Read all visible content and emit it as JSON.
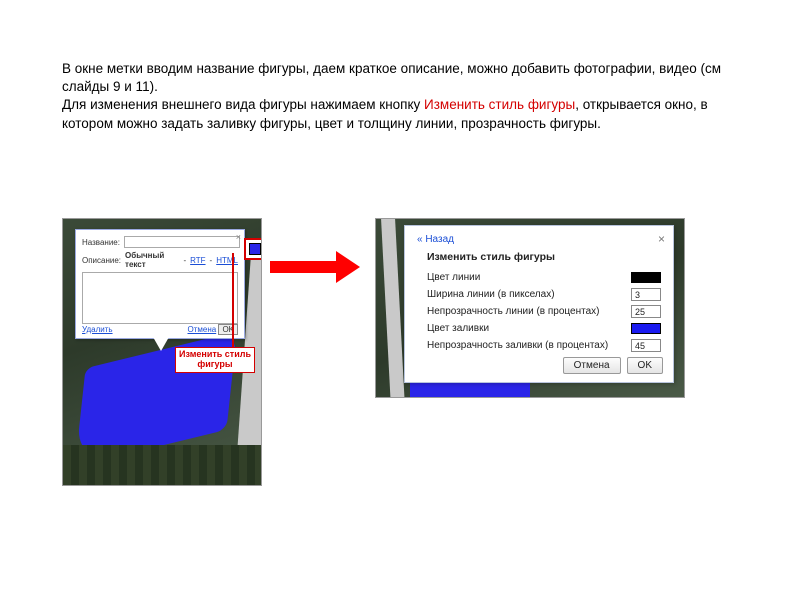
{
  "description": {
    "line1": "В окне метки вводим название фигуры, даем краткое описание, можно добавить фотографии, видео (см слайды 9 и 11).",
    "line2_pre": "Для изменения внешнего вида фигуры нажимаем кнопку ",
    "line2_hl": "Изменить стиль фигуры",
    "line2_post": ", открывается окно, в котором можно задать заливку фигуры, цвет и толщину линии, прозрачность фигуры."
  },
  "popup": {
    "name_label": "Название:",
    "desc_label": "Описание:",
    "plain_text": "Обычный текст",
    "rtf": "RTF",
    "html": "HTML",
    "delete": "Удалить",
    "cancel": "Отмена",
    "ok": "OK"
  },
  "callout": {
    "line1": "Изменить стиль",
    "line2": "фигуры"
  },
  "dialog": {
    "back": "« Назад",
    "title": "Изменить стиль фигуры",
    "rows": {
      "line_color": {
        "label": "Цвет линии",
        "swatch": "#000000"
      },
      "line_width": {
        "label": "Ширина линии (в пикселах)",
        "value": "3"
      },
      "line_opacity": {
        "label": "Непрозрачность линии (в процентах)",
        "value": "25"
      },
      "fill_color": {
        "label": "Цвет заливки",
        "swatch": "#1a1af0"
      },
      "fill_opacity": {
        "label": "Непрозрачность заливки (в процентах)",
        "value": "45"
      }
    },
    "cancel": "Отмена",
    "ok": "OK"
  }
}
